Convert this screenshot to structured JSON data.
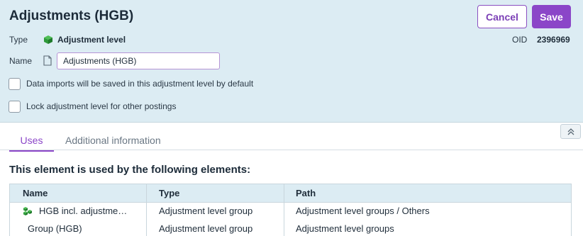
{
  "header": {
    "title": "Adjustments (HGB)",
    "cancel_label": "Cancel",
    "save_label": "Save"
  },
  "fields": {
    "type_label": "Type",
    "type_value": "Adjustment level",
    "oid_label": "OID",
    "oid_value": "2396969",
    "name_label": "Name",
    "name_value": "Adjustments (HGB)"
  },
  "options": [
    {
      "label": "Data imports will be saved in this adjustment level by default",
      "checked": false
    },
    {
      "label": "Lock adjustment level for other postings",
      "checked": false
    }
  ],
  "tabs": [
    {
      "label": "Uses",
      "active": true
    },
    {
      "label": "Additional information",
      "active": false
    }
  ],
  "uses": {
    "heading": "This element is used by the following elements:",
    "columns": [
      "Name",
      "Type",
      "Path"
    ],
    "rows": [
      {
        "name": "HGB incl. adjustme…",
        "icon": "group-icon",
        "type": "Adjustment level group",
        "path": "Adjustment level groups / Others"
      },
      {
        "name": "Group (HGB)",
        "icon": "",
        "type": "Adjustment level group",
        "path": "Adjustment level groups"
      }
    ]
  },
  "colors": {
    "accent": "#8b46c8",
    "header_bg": "#dcecf3",
    "icon_green": "#2e9a3a"
  },
  "icons": {
    "type": "cube-icon",
    "name": "document-icon",
    "collapse": "double-chevron-up-icon"
  }
}
